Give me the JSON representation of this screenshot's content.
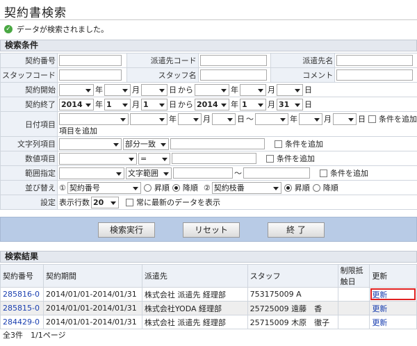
{
  "page": {
    "title": "契約書検索",
    "message": "データが検索されました。"
  },
  "search": {
    "header": "検索条件",
    "labels": {
      "contract_no": "契約番号",
      "dispatch_code": "派遣先コード",
      "dispatch_name": "派遣先名",
      "staff_code": "スタッフコード",
      "staff_name": "スタッフ名",
      "comment": "コメント",
      "contract_start": "契約開始",
      "contract_end": "契約終了",
      "date_item": "日付項目",
      "string_item": "文字列項目",
      "number_item": "数値項目",
      "range": "範囲指定",
      "sort": "並び替え",
      "settings": "設定"
    },
    "units": {
      "year": "年",
      "month": "月",
      "day": "日",
      "from": "から",
      "tilde": "～"
    },
    "contract_end": {
      "year": "2014",
      "month": "1",
      "day1": "1",
      "year2": "2014",
      "month2": "1",
      "day2": "31"
    },
    "add_condition": "条件を追加",
    "date_add_condition_line2": "項目を追加",
    "match_partial": "部分一致",
    "equals": "=",
    "text_range": "文字範囲",
    "sort": {
      "one": "①",
      "two": "②",
      "key1": "契約番号",
      "key2": "契約枝番",
      "asc": "昇順",
      "desc": "降順"
    },
    "settings": {
      "rows_label": "表示行数",
      "rows_value": "20",
      "latest_label": "常に最新のデータを表示"
    }
  },
  "buttons": {
    "search": "検索実行",
    "reset": "リセット",
    "exit": "終 了"
  },
  "results": {
    "header": "検索結果",
    "columns": [
      "契約番号",
      "契約期間",
      "派遣先",
      "スタッフ",
      "制限抵触日",
      "更新"
    ],
    "rows": [
      {
        "no": "285816-0",
        "period": "2014/01/01-2014/01/31",
        "dest": "株式会社 派遣先 経理部",
        "staff": "753175009 A",
        "limit": "",
        "update": "更新"
      },
      {
        "no": "285815-0",
        "period": "2014/01/01-2014/01/31",
        "dest": "株式会社YODA 経理部",
        "staff": "25725009 遠藤　香",
        "limit": "",
        "update": "更新"
      },
      {
        "no": "284429-0",
        "period": "2014/01/01-2014/01/31",
        "dest": "株式会社 派遣先 経理部",
        "staff": "25715009 木原　徹子",
        "limit": "",
        "update": "更新"
      }
    ]
  },
  "footer": {
    "summary": "全3件　1/1ページ"
  }
}
